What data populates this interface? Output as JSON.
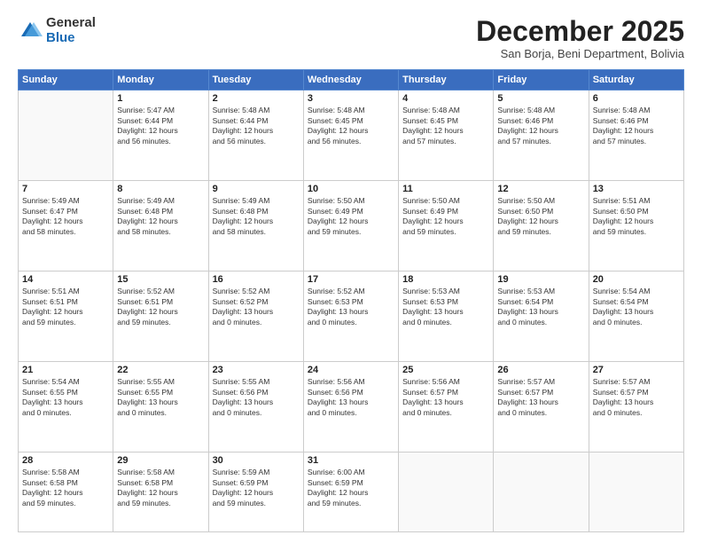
{
  "logo": {
    "general": "General",
    "blue": "Blue"
  },
  "header": {
    "month": "December 2025",
    "location": "San Borja, Beni Department, Bolivia"
  },
  "weekdays": [
    "Sunday",
    "Monday",
    "Tuesday",
    "Wednesday",
    "Thursday",
    "Friday",
    "Saturday"
  ],
  "weeks": [
    [
      {
        "day": "",
        "info": ""
      },
      {
        "day": "1",
        "info": "Sunrise: 5:47 AM\nSunset: 6:44 PM\nDaylight: 12 hours\nand 56 minutes."
      },
      {
        "day": "2",
        "info": "Sunrise: 5:48 AM\nSunset: 6:44 PM\nDaylight: 12 hours\nand 56 minutes."
      },
      {
        "day": "3",
        "info": "Sunrise: 5:48 AM\nSunset: 6:45 PM\nDaylight: 12 hours\nand 56 minutes."
      },
      {
        "day": "4",
        "info": "Sunrise: 5:48 AM\nSunset: 6:45 PM\nDaylight: 12 hours\nand 57 minutes."
      },
      {
        "day": "5",
        "info": "Sunrise: 5:48 AM\nSunset: 6:46 PM\nDaylight: 12 hours\nand 57 minutes."
      },
      {
        "day": "6",
        "info": "Sunrise: 5:48 AM\nSunset: 6:46 PM\nDaylight: 12 hours\nand 57 minutes."
      }
    ],
    [
      {
        "day": "7",
        "info": "Sunrise: 5:49 AM\nSunset: 6:47 PM\nDaylight: 12 hours\nand 58 minutes."
      },
      {
        "day": "8",
        "info": "Sunrise: 5:49 AM\nSunset: 6:48 PM\nDaylight: 12 hours\nand 58 minutes."
      },
      {
        "day": "9",
        "info": "Sunrise: 5:49 AM\nSunset: 6:48 PM\nDaylight: 12 hours\nand 58 minutes."
      },
      {
        "day": "10",
        "info": "Sunrise: 5:50 AM\nSunset: 6:49 PM\nDaylight: 12 hours\nand 59 minutes."
      },
      {
        "day": "11",
        "info": "Sunrise: 5:50 AM\nSunset: 6:49 PM\nDaylight: 12 hours\nand 59 minutes."
      },
      {
        "day": "12",
        "info": "Sunrise: 5:50 AM\nSunset: 6:50 PM\nDaylight: 12 hours\nand 59 minutes."
      },
      {
        "day": "13",
        "info": "Sunrise: 5:51 AM\nSunset: 6:50 PM\nDaylight: 12 hours\nand 59 minutes."
      }
    ],
    [
      {
        "day": "14",
        "info": "Sunrise: 5:51 AM\nSunset: 6:51 PM\nDaylight: 12 hours\nand 59 minutes."
      },
      {
        "day": "15",
        "info": "Sunrise: 5:52 AM\nSunset: 6:51 PM\nDaylight: 12 hours\nand 59 minutes."
      },
      {
        "day": "16",
        "info": "Sunrise: 5:52 AM\nSunset: 6:52 PM\nDaylight: 13 hours\nand 0 minutes."
      },
      {
        "day": "17",
        "info": "Sunrise: 5:52 AM\nSunset: 6:53 PM\nDaylight: 13 hours\nand 0 minutes."
      },
      {
        "day": "18",
        "info": "Sunrise: 5:53 AM\nSunset: 6:53 PM\nDaylight: 13 hours\nand 0 minutes."
      },
      {
        "day": "19",
        "info": "Sunrise: 5:53 AM\nSunset: 6:54 PM\nDaylight: 13 hours\nand 0 minutes."
      },
      {
        "day": "20",
        "info": "Sunrise: 5:54 AM\nSunset: 6:54 PM\nDaylight: 13 hours\nand 0 minutes."
      }
    ],
    [
      {
        "day": "21",
        "info": "Sunrise: 5:54 AM\nSunset: 6:55 PM\nDaylight: 13 hours\nand 0 minutes."
      },
      {
        "day": "22",
        "info": "Sunrise: 5:55 AM\nSunset: 6:55 PM\nDaylight: 13 hours\nand 0 minutes."
      },
      {
        "day": "23",
        "info": "Sunrise: 5:55 AM\nSunset: 6:56 PM\nDaylight: 13 hours\nand 0 minutes."
      },
      {
        "day": "24",
        "info": "Sunrise: 5:56 AM\nSunset: 6:56 PM\nDaylight: 13 hours\nand 0 minutes."
      },
      {
        "day": "25",
        "info": "Sunrise: 5:56 AM\nSunset: 6:57 PM\nDaylight: 13 hours\nand 0 minutes."
      },
      {
        "day": "26",
        "info": "Sunrise: 5:57 AM\nSunset: 6:57 PM\nDaylight: 13 hours\nand 0 minutes."
      },
      {
        "day": "27",
        "info": "Sunrise: 5:57 AM\nSunset: 6:57 PM\nDaylight: 13 hours\nand 0 minutes."
      }
    ],
    [
      {
        "day": "28",
        "info": "Sunrise: 5:58 AM\nSunset: 6:58 PM\nDaylight: 12 hours\nand 59 minutes."
      },
      {
        "day": "29",
        "info": "Sunrise: 5:58 AM\nSunset: 6:58 PM\nDaylight: 12 hours\nand 59 minutes."
      },
      {
        "day": "30",
        "info": "Sunrise: 5:59 AM\nSunset: 6:59 PM\nDaylight: 12 hours\nand 59 minutes."
      },
      {
        "day": "31",
        "info": "Sunrise: 6:00 AM\nSunset: 6:59 PM\nDaylight: 12 hours\nand 59 minutes."
      },
      {
        "day": "",
        "info": ""
      },
      {
        "day": "",
        "info": ""
      },
      {
        "day": "",
        "info": ""
      }
    ]
  ]
}
